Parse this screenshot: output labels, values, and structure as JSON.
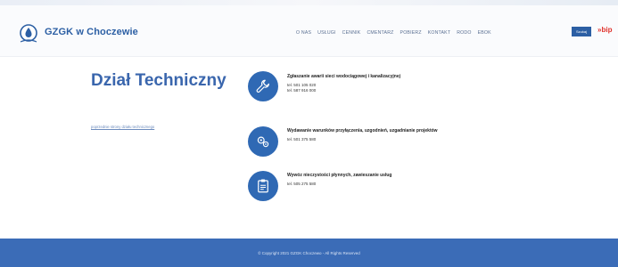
{
  "header": {
    "brand": "GZGK w Choczewie",
    "nav": [
      "O NAS",
      "USŁUGI",
      "CENNIK",
      "CMENTARZ",
      "POBIERZ",
      "KONTAKT",
      "RODO",
      "EBOK"
    ],
    "search_label": "Szukaj",
    "bip_label": "bip"
  },
  "main": {
    "title": "Dział Techniczny",
    "side_link": "poprzednie strony działu technicznego",
    "items": [
      {
        "icon": "wrench-icon",
        "title": "Zgłaszanie awarii sieci wodociągowej i kanalizacyjnej",
        "phones": [
          "tel. 501 105 020",
          "tel. 587 916 000"
        ]
      },
      {
        "icon": "gears-icon",
        "title": "Wydawanie warunków przyłączenia, uzgodnień, uzgadnianie projektów",
        "phones": [
          "tel. 501 375 580"
        ]
      },
      {
        "icon": "clipboard-icon",
        "title": "Wywóz nieczystości płynnych, zawieszanie usług",
        "phones": [
          "tel. 505 275 580"
        ]
      }
    ]
  },
  "footer": {
    "copyright": "© Copyright 2021 GZGK Choczewo - All Rights Reserved"
  }
}
